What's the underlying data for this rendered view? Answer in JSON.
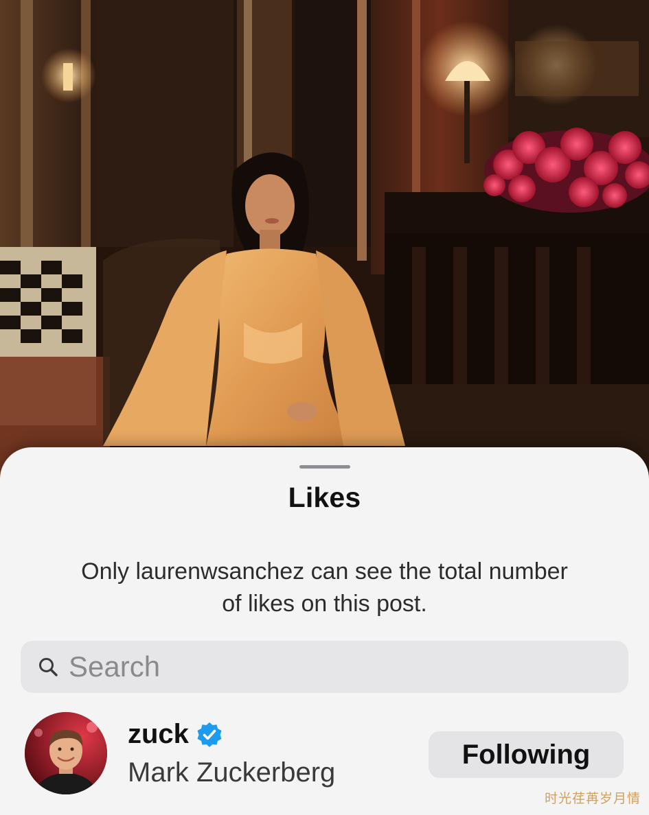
{
  "sheet": {
    "title": "Likes",
    "notice": "Only laurenwsanchez can see the total number of likes on this post."
  },
  "search": {
    "placeholder": "Search",
    "value": "",
    "icon": "search-icon"
  },
  "likes_list": [
    {
      "username": "zuck",
      "full_name": "Mark Zuckerberg",
      "verified": true,
      "button_label": "Following"
    }
  ],
  "watermark": "时光荏苒岁月情",
  "colors": {
    "sheet_background": "#f4f4f5",
    "search_background": "#e6e6e9",
    "button_background": "#e4e4e7",
    "verified_blue": "#1d9bf0",
    "dress": "#e2a15c",
    "flowers": "#d0284a"
  }
}
